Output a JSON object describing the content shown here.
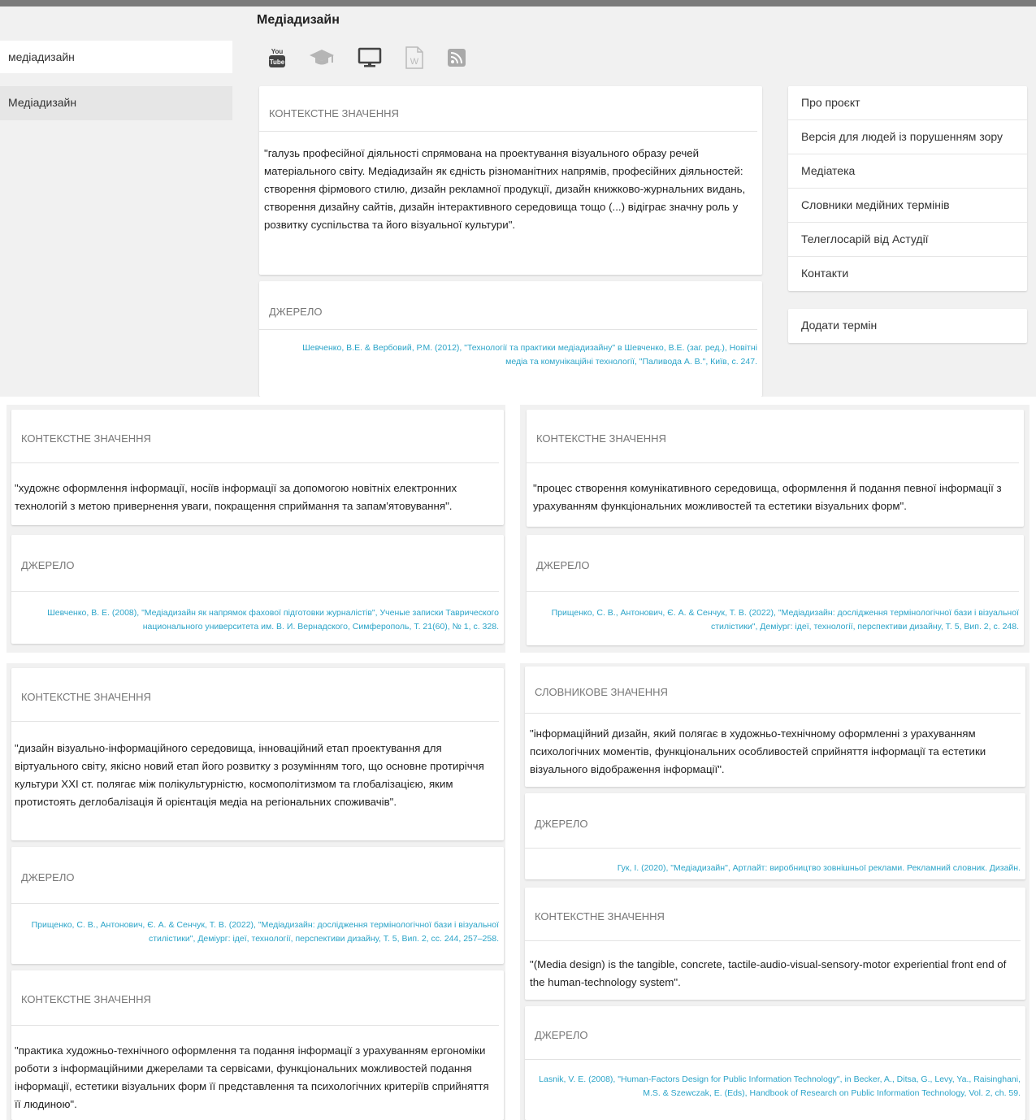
{
  "header": {
    "title": "Медіадизайн"
  },
  "search": {
    "value": "медіадизайн"
  },
  "term_list": [
    "Медіадизайн"
  ],
  "icons": [
    "youtube-icon",
    "graduation-cap-icon",
    "monitor-icon",
    "word-document-icon",
    "rss-icon"
  ],
  "sidebar_menu": {
    "items": [
      "Про проєкт",
      "Версія для людей із порушенням зору",
      "Медіатека",
      "Словники медійних термінів",
      "Телеглосарій від Астудії",
      "Контакти"
    ],
    "add_term": "Додати термін"
  },
  "top": {
    "context_head": "КОНТЕКСТНЕ ЗНАЧЕННЯ",
    "context_text": "\"галузь професійної діяльності спрямована на проектування візуального образу речей матеріального світу. Медіадизайн як єдність різноманітних напрямів, професійних діяльностей: створення фірмового стилю, дизайн рекламної продукції, дизайн книжково-журнальних видань, створення дизайну сайтів, дизайн інтерактивного середовища тощо (...) відіграє значну роль у розвитку суспільства та його візуальної культури\".",
    "source_head": "ДЖЕРЕЛО",
    "source_text": "Шевченко, В.Е. & Вербовий, Р.М. (2012), \"Технології та практики медіадизайну\" в Шевченко, В.Е. (заг. ред.), Новітні медіа та комунікаційні технології, \"Паливода А. В.\", Київ, с. 247."
  },
  "mid_left": {
    "context_head": "КОНТЕКСТНЕ ЗНАЧЕННЯ",
    "context_text": "\"художнє оформлення інформації, носіїв інформації за допомогою новітніх електронних технологій з метою привернення уваги, покращення сприймання та запам'ятовування\".",
    "source_head": "ДЖЕРЕЛО",
    "source_text": "Шевченко, В. Е. (2008), \"Медіадизайн як напрямок фахової підготовки журналістів\", Ученые записки Таврического национального университета им. В. И. Вернадского, Симферополь, Т. 21(60), № 1, с. 328."
  },
  "mid_right": {
    "context_head": "КОНТЕКСТНЕ ЗНАЧЕННЯ",
    "context_text": "\"процес створення комунікативного середовища, оформлення й подання певної інформації з урахуванням функціональних можливостей та естетики візуальних форм\".",
    "source_head": "ДЖЕРЕЛО",
    "source_text": "Прищенко, С. В., Антонович, Є. А. & Сенчук, Т. В. (2022), \"Медіадизайн: дослідження термінологічної бази і візуальної стилістики\", Деміург: ідеї, технології, перспективи дизайну, Т. 5, Вип. 2, с. 248."
  },
  "bottom_left": {
    "context_head": "КОНТЕКСТНЕ ЗНАЧЕННЯ",
    "context_text": "\"дизайн візуально-інформаційного середовища, інноваційний етап проектування для віртуального світу, якісно новий етап його розвитку з розумінням того, що основне протиріччя культури XXI ст. полягає між полікультурністю, космополітизмом та глобалізацією, яким протистоять деглобалізація й орієнтація медіа на регіональних споживачів\".",
    "source_head": "ДЖЕРЕЛО",
    "source_text": "Прищенко, С. В., Антонович, Є. А. & Сенчук, Т. В. (2022), \"Медіадизайн: дослідження термінологічної бази і візуальної стилістики\", Деміург: ідеї, технології, перспективи дизайну, Т. 5, Вип. 2, сс. 244, 257–258.",
    "context2_head": "КОНТЕКСТНЕ ЗНАЧЕННЯ",
    "context2_text": "\"практика художньо-технічного оформлення та подання інформації з урахуванням ергономіки роботи з інформаційними джерелами та сервісами, функціональних можливостей подання інформації, естетики візуальних форм її представлення та психологічних критеріїв сприйняття її людиною\"."
  },
  "bottom_right": {
    "dict_head": "СЛОВНИКОВЕ ЗНАЧЕННЯ",
    "dict_text": "\"інформаційний дизайн, який полягає в художньо-технічному оформленні з урахуванням психологічних моментів, функціональних особливостей сприйняття інформації та естетики візуального відображення інформації\".",
    "source_head": "ДЖЕРЕЛО",
    "source_text": "Гук, І. (2020), \"Медіадизайн\", Артлайт: виробництво зовнішньої реклами. Рекламний словник. Дизайн.",
    "context_head": "КОНТЕКСТНЕ ЗНАЧЕННЯ",
    "context_text": "\"(Media design) is the tangible, concrete, tactile-audio-visual-sensory-motor experiential front end of the human-technology system\".",
    "source2_head": "ДЖЕРЕЛО",
    "source2_text": "Lasnik, V. E. (2008), \"Human-Factors Design for Public Information Technology\", in Becker, A., Ditsa, G., Levy, Ya., Raisinghani, M.S. & Szewczak, E. (Eds), Handbook of Research on Public Information Technology, Vol. 2, ch. 59."
  }
}
